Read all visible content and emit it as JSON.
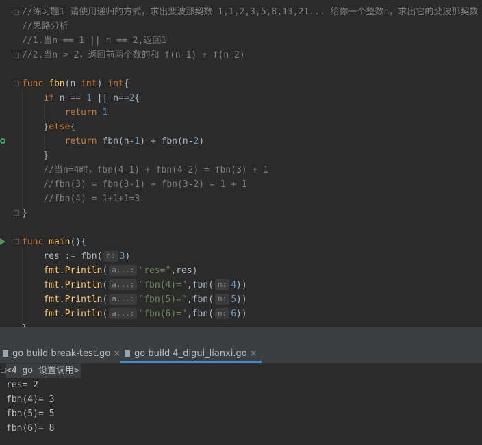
{
  "editor": {
    "lines": {
      "l1": "//练习题1 请使用递归的方式，求出斐波那契数 1,1,2,3,5,8,13,21... 给你一个整数n，求出它的斐波那契数",
      "l2": "//思路分析",
      "l3": "//1.当n == 1 || n == 2,返回1",
      "l4": "//2.当n > 2，返回前两个数的和 f(n-1) + f(n-2)",
      "l9_cm": "//当n=4时，fbn(4-1) + fbn(4-2) = fbn(3) + 1",
      "l10_cm": "//fbn(3) = fbn(3-1) + fbn(3-2) = 1 + 1",
      "l11_cm": "//fbn(4) = 1+1+1=3"
    },
    "kw_func": "func",
    "kw_if": "if",
    "kw_return": "return",
    "kw_else": "else",
    "kw_int": "int",
    "fbn": "fbn",
    "main": "main",
    "fmt": "fmt",
    "println": "Println",
    "hint_n": "n:",
    "hint_a": "a...:",
    "str_res": "\"res=\"",
    "str_fbn4": "\"fbn(4)=\"",
    "str_fbn5": "\"fbn(5)=\"",
    "str_fbn6": "\"fbn(6)=\"",
    "n1": "1",
    "n2": "2",
    "n3": "3",
    "n4": "4",
    "n5": "5",
    "n6": "6",
    "colors": {
      "keyword": "#cc7832",
      "number": "#6897bb",
      "function": "#ffc66d",
      "string": "#6a8759",
      "comment": "#808080"
    }
  },
  "tabs": [
    {
      "label": "go build break-test.go",
      "close": "×",
      "icon": "file-icon"
    },
    {
      "label": "go build 4_digui_lianxi.go",
      "close": "×",
      "icon": "go-file-icon"
    }
  ],
  "console": {
    "header": "<4 go 设置调用>",
    "lines": [
      "res= 2",
      "fbn(4)= 3",
      "fbn(5)= 5",
      "fbn(6)= 8"
    ]
  }
}
